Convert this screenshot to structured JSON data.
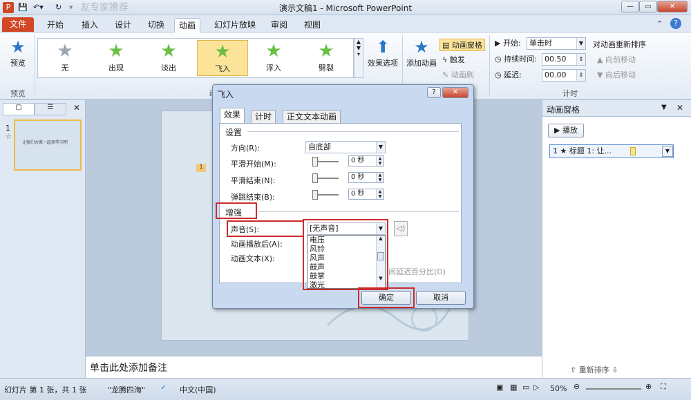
{
  "window": {
    "title": "演示文稿1 - Microsoft PowerPoint",
    "watermark": "友专家推荐"
  },
  "tabs": {
    "file": "文件",
    "items": [
      "开始",
      "插入",
      "设计",
      "切换",
      "动画",
      "幻灯片放映",
      "审阅",
      "视图"
    ]
  },
  "ribbon": {
    "preview": "预览",
    "preview_group": "预览",
    "gallery": [
      "无",
      "出现",
      "淡出",
      "飞入",
      "浮入",
      "劈裂"
    ],
    "effect_options": "效果选项",
    "add_animation": "添加动画",
    "anim_pane_btn": "动画窗格",
    "trigger": "触发",
    "anim_painter": "动画刷",
    "start_label": "开始:",
    "start_value": "单击时",
    "duration_label": "持续时间:",
    "duration_value": "00.50",
    "delay_label": "延迟:",
    "delay_value": "00.00",
    "reorder_title": "对动画重新排序",
    "move_earlier": "向前移动",
    "move_later": "向后移动",
    "timing_group": "计时",
    "anim_group_prefix": "动"
  },
  "slides": {
    "number": "1",
    "slide_text": "让我们大家一起来学习吧"
  },
  "notes": "单击此处添加备注",
  "anim_pane": {
    "title": "动画窗格",
    "play": "播放",
    "item": "1 ★ 标题 1: 让...",
    "reorder": "重新排序"
  },
  "status": {
    "slide_info": "幻灯片 第 1 张，共 1 张",
    "theme": "\"龙腾四海\"",
    "lang": "中文(中国)",
    "zoom": "50%"
  },
  "dialog": {
    "title": "飞入",
    "tabs": [
      "效果",
      "计时",
      "正文文本动画"
    ],
    "settings_title": "设置",
    "direction_label": "方向(R):",
    "direction_value": "自底部",
    "smooth_start": "平滑开始(M):",
    "smooth_end": "平滑结束(N):",
    "bounce_end": "弹跳结束(B):",
    "seconds_value": "0 秒",
    "enhance_title": "增强",
    "sound_label": "声音(S):",
    "sound_value": "[无声音]",
    "after_anim": "动画播放后(A):",
    "anim_text": "动画文本(X):",
    "sound_options": [
      "电压",
      "风铃",
      "风声",
      "鼓声",
      "鼓掌",
      "激光"
    ],
    "delay_pct": "间延迟百分比(D)",
    "ok": "确定",
    "cancel": "取消"
  },
  "colors": {
    "accent_red": "#cc2b2b",
    "file_tab": "#d24726",
    "selected_gallery": "#fbe49a"
  }
}
